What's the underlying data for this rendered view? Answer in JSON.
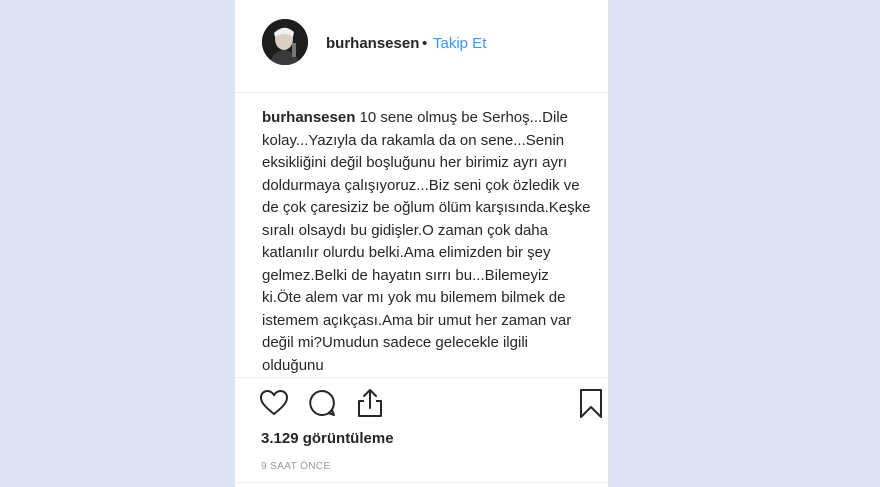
{
  "post": {
    "username": "burhansesen",
    "separator": "•",
    "follow_label": "Takip Et",
    "caption_user": "burhansesen",
    "caption_text": "10 sene olmuş be Serhoş...Dile kolay...Yazıyla da rakamla da on sene...Senin eksikliğini değil boşluğunu her birimiz ayrı ayrı doldurmaya çalışıyoruz...Biz seni çok özledik ve de çok çaresiziz be oğlum ölüm karşısında.Keşke sıralı olsaydı bu gidişler.O zaman çok daha katlanılır olurdu belki.Ama elimizden bir şey gelmez.Belki de hayatın sırrı bu...Bilemeyiz ki.Öte alem var mı yok mu bilemem bilmek de istemem açıkçası.Ama bir umut her zaman var değil mi?Umudun sadece gelecekle ilgili olduğunu",
    "views": "3.129 görüntüleme",
    "time_ago": "9 SAAT ÖNCE"
  },
  "icons": {
    "avatar": "profile-photo",
    "like": "heart-icon",
    "comment": "comment-icon",
    "share": "share-icon",
    "save": "bookmark-icon"
  },
  "colors": {
    "background": "#dde3f3",
    "card": "#ffffff",
    "text": "#262626",
    "link": "#3897f0",
    "muted": "#999999"
  }
}
